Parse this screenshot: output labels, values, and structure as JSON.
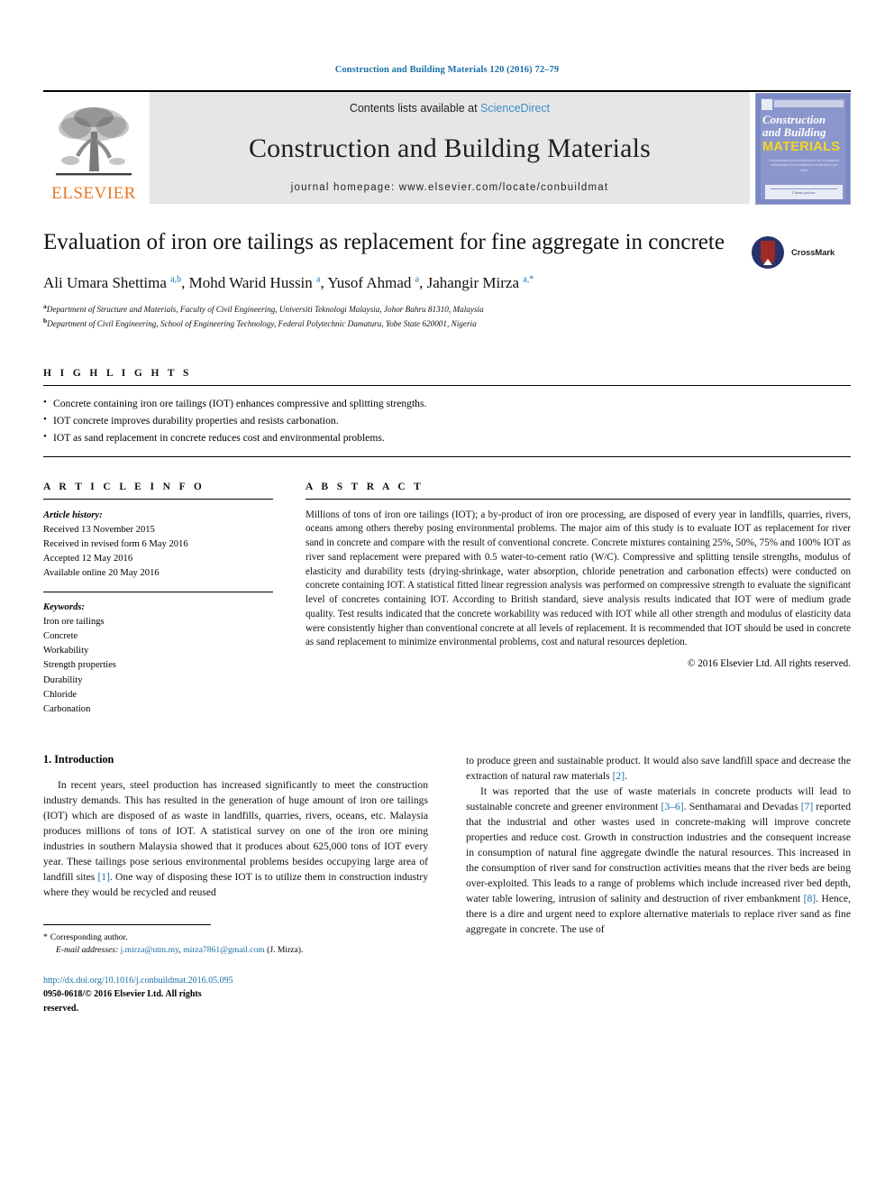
{
  "running_head": "Construction and Building Materials 120 (2016) 72–79",
  "masthead": {
    "publisher_name": "ELSEVIER",
    "contents_prefix": "Contents lists available at",
    "contents_link": "ScienceDirect",
    "journal_title": "Construction and Building Materials",
    "homepage_label": "journal homepage: www.elsevier.com/locate/conbuildmat",
    "cover": {
      "line1": "Construction",
      "line2": "and Building",
      "line3": "MATERIALS",
      "blurb": "An international journal dedicated to the investigation and innovative use of materials in construction and repair",
      "footer": "Library policies"
    }
  },
  "article": {
    "title": "Evaluation of iron ore tailings as replacement for fine aggregate in concrete",
    "crossmark_label": "CrossMark",
    "authors_html": "Ali Umara Shettima <sup>a,b</sup>, Mohd Warid Hussin <sup>a</sup>, Yusof Ahmad <sup>a</sup>, Jahangir Mirza <sup>a,*</sup>",
    "affiliations": [
      "Department of Structure and Materials, Faculty of Civil Engineering, Universiti Teknologi Malaysia, Johor Bahru 81310, Malaysia",
      "Department of Civil Engineering, School of Engineering Technology, Federal Polytechnic Damaturu, Yobe State 620001, Nigeria"
    ],
    "affiliation_marks": [
      "a",
      "b"
    ]
  },
  "highlights": {
    "heading": "H I G H L I G H T S",
    "items": [
      "Concrete containing iron ore tailings (IOT) enhances compressive and splitting strengths.",
      "IOT concrete improves durability properties and resists carbonation.",
      "IOT as sand replacement in concrete reduces cost and environmental problems."
    ]
  },
  "article_info": {
    "heading": "A R T I C L E   I N F O",
    "history_label": "Article history:",
    "history": [
      "Received 13 November 2015",
      "Received in revised form 6 May 2016",
      "Accepted 12 May 2016",
      "Available online 20 May 2016"
    ],
    "keywords_label": "Keywords:",
    "keywords": [
      "Iron ore tailings",
      "Concrete",
      "Workability",
      "Strength properties",
      "Durability",
      "Chloride",
      "Carbonation"
    ]
  },
  "abstract": {
    "heading": "A B S T R A C T",
    "text": "Millions of tons of iron ore tailings (IOT); a by-product of iron ore processing, are disposed of every year in landfills, quarries, rivers, oceans among others thereby posing environmental problems. The major aim of this study is to evaluate IOT as replacement for river sand in concrete and compare with the result of conventional concrete. Concrete mixtures containing 25%, 50%, 75% and 100% IOT as river sand replacement were prepared with 0.5 water-to-cement ratio (W/C). Compressive and splitting tensile strengths, modulus of elasticity and durability tests (drying-shrinkage, water absorption, chloride penetration and carbonation effects) were conducted on concrete containing IOT. A statistical fitted linear regression analysis was performed on compressive strength to evaluate the significant level of concretes containing IOT. According to British standard, sieve analysis results indicated that IOT were of medium grade quality. Test results indicated that the concrete workability was reduced with IOT while all other strength and modulus of elasticity data were consistently higher than conventional concrete at all levels of replacement. It is recommended that IOT should be used in concrete as sand replacement to minimize environmental problems, cost and natural resources depletion.",
    "copyright": "© 2016 Elsevier Ltd. All rights reserved."
  },
  "introduction": {
    "section_title": "1. Introduction",
    "left_paragraph_part1": "In recent years, steel production has increased significantly to meet the construction industry demands. This has resulted in the generation of huge amount of iron ore tailings (IOT) which are disposed of as waste in landfills, quarries, rivers, oceans, etc. Malaysia produces millions of tons of IOT. A statistical survey on one of the iron ore mining industries in southern Malaysia showed that it produces about 625,000 tons of IOT every year. These tailings pose serious environmental problems besides occupying large area of landfill sites ",
    "left_cite1": "[1]",
    "left_paragraph_part2": ". One way of disposing these IOT is to utilize them in construction industry where they would be recycled and reused ",
    "right_paragraph_part1": "to produce green and sustainable product. It would also save landfill space and decrease the extraction of natural raw materials ",
    "right_cite2": "[2]",
    "right_paragraph_part2": ".",
    "right_p2_part1": "It was reported that the use of waste materials in concrete products will lead to sustainable concrete and greener environment ",
    "right_cite36": "[3–6]",
    "right_p2_part2": ". Senthamarai and Devadas ",
    "right_cite7": "[7]",
    "right_p2_part3": " reported that the industrial and other wastes used in concrete-making will improve concrete properties and reduce cost. Growth in construction industries and the consequent increase in consumption of natural fine aggregate dwindle the natural resources. This increased in the consumption of river sand for construction activities means that the river beds are being over-exploited. This leads to a range of problems which include increased river bed depth, water table lowering, intrusion of salinity and destruction of river embankment ",
    "right_cite8": "[8]",
    "right_p2_part4": ". Hence, there is a dire and urgent need to explore alternative materials to replace river sand as fine aggregate in concrete. The use of"
  },
  "footnote": {
    "star": "*",
    "corresponding": "Corresponding author.",
    "email_label": "E-mail addresses:",
    "email1": "j.mirza@utm.my",
    "email_sep": ", ",
    "email2": "mirza7861@gmail.com",
    "email_suffix": " (J. Mirza).",
    "doi": "http://dx.doi.org/10.1016/j.conbuildmat.2016.05.095",
    "issn": "0950-0618/© 2016 Elsevier Ltd. All rights reserved."
  },
  "colors": {
    "link_blue": "#1a6fa8",
    "sciencedirect_blue": "#3a8fc4",
    "elsevier_orange": "#E87722",
    "cover_blue": "#8b97cc",
    "cover_yellow": "#f5d623",
    "crossmark_red": "#9e2b25",
    "crossmark_blue": "#27326b"
  }
}
